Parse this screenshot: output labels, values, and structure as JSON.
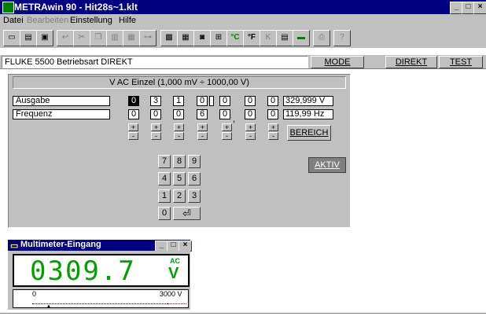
{
  "window": {
    "title": "METRAwin 90 - Hit28s~1.klt"
  },
  "menu": [
    {
      "label": "Datei",
      "enabled": true
    },
    {
      "label": "Bearbeiten",
      "enabled": false
    },
    {
      "label": "Einstellung",
      "enabled": true
    },
    {
      "label": "Hilfe",
      "enabled": true
    }
  ],
  "toolbar": {
    "celsius": "°C",
    "fahrenheit": "°F",
    "kelvin": "K",
    "help": "?"
  },
  "status_row": {
    "device": "FLUKE 5500  Betriebsart DIREKT",
    "mode": "MODE",
    "direkt": "DIREKT",
    "test": "TEST"
  },
  "calibrator": {
    "range_label": "V AC Einzel  (1,000 mV ÷ 1000,00 V)",
    "ausgabe_label": "Ausgabe",
    "frequenz_label": "Frequenz",
    "ausgabe_digits": [
      "0",
      "3",
      "1",
      "0",
      "0",
      "0",
      "0"
    ],
    "frequenz_digits": [
      "0",
      "0",
      "0",
      "6",
      "0",
      "0",
      "0"
    ],
    "ausgabe_value": "329,999 V",
    "frequenz_value": "119,99 Hz",
    "plus": "+",
    "minus": "-",
    "bereich": "BEREICH",
    "aktiv": "AKTIV"
  },
  "keypad": {
    "k7": "7",
    "k8": "8",
    "k9": "9",
    "k4": "4",
    "k5": "5",
    "k6": "6",
    "k1": "1",
    "k2": "2",
    "k3": "3",
    "k0": "0",
    "enter": "⏎"
  },
  "multimeter": {
    "title": "Multimeter-Eingang",
    "reading": "0309.7",
    "ac": "AC",
    "unit": "V",
    "scale_min": "0",
    "scale_max": "3000 V"
  }
}
